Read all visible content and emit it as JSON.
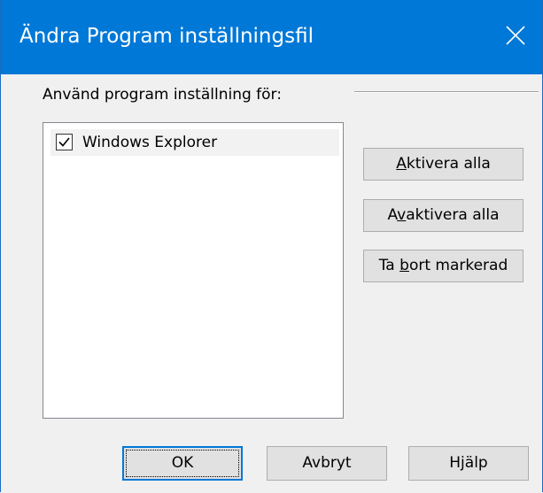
{
  "window": {
    "title": "Ändra Program inställningsfil",
    "accent_color": "#0078d7",
    "close_icon": "close-icon"
  },
  "group": {
    "label": "Använd program inställning för:"
  },
  "programs": [
    {
      "label": "Windows Explorer",
      "checked": true
    }
  ],
  "buttons": {
    "activate_all": {
      "pre": "",
      "accel": "A",
      "post": "ktivera alla"
    },
    "deactivate_all": {
      "pre": "A",
      "accel": "v",
      "post": "aktivera alla"
    },
    "remove_selected": {
      "pre": "Ta ",
      "accel": "b",
      "post": "ort markerad"
    },
    "ok": "OK",
    "cancel": "Avbryt",
    "help": "Hjälp"
  }
}
